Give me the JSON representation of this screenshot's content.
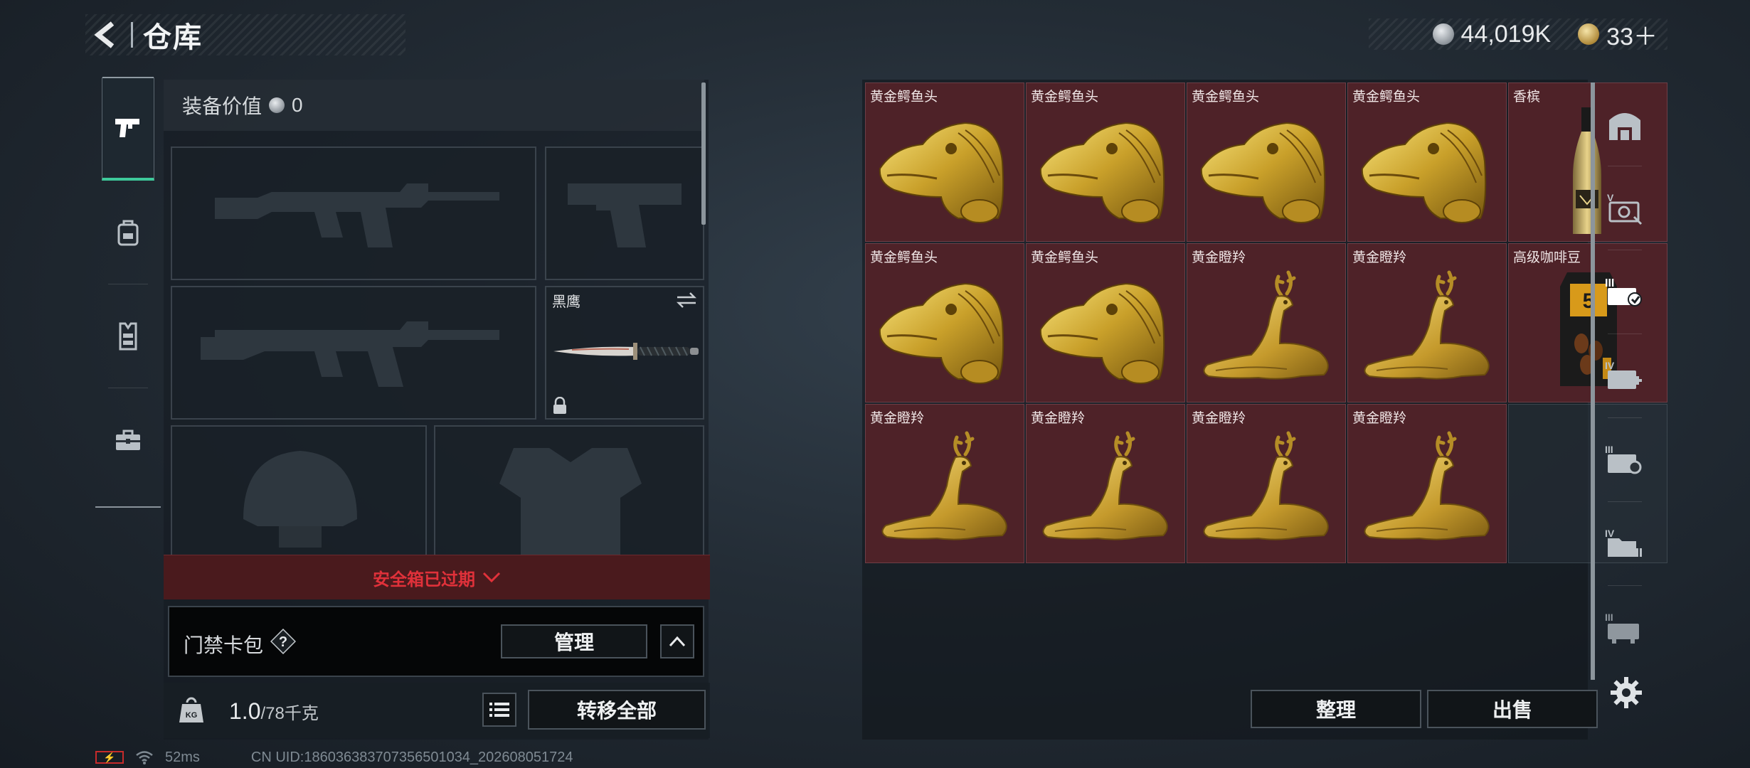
{
  "header": {
    "title": "仓库",
    "silver_amount": "44,019K",
    "gold_amount": "33＋"
  },
  "side_nav": {
    "items": [
      "pistol-icon",
      "backpack-icon",
      "vest-icon",
      "case-icon"
    ],
    "active_index": 0
  },
  "loadout": {
    "equipment_value_label": "装备价值",
    "equipment_value": "0",
    "melee_slot_label": "黑鹰",
    "safe_box_status": "安全箱已过期",
    "keycard": {
      "label": "门禁卡包",
      "help": "?",
      "manage_label": "管理"
    },
    "weight": {
      "current": "1.0",
      "capacity": "/78千克"
    },
    "transfer_all_label": "转移全部"
  },
  "storage": {
    "items": [
      {
        "label": "黄金鳄鱼头",
        "icon": "golden-crocodile-head"
      },
      {
        "label": "黄金鳄鱼头",
        "icon": "golden-crocodile-head"
      },
      {
        "label": "黄金鳄鱼头",
        "icon": "golden-crocodile-head"
      },
      {
        "label": "黄金鳄鱼头",
        "icon": "golden-crocodile-head"
      },
      {
        "label": "香槟",
        "icon": "champagne-bottle"
      },
      {
        "label": "黄金鳄鱼头",
        "icon": "golden-crocodile-head"
      },
      {
        "label": "黄金鳄鱼头",
        "icon": "golden-crocodile-head"
      },
      {
        "label": "黄金瞪羚",
        "icon": "golden-gazelle"
      },
      {
        "label": "黄金瞪羚",
        "icon": "golden-gazelle"
      },
      {
        "label": "高级咖啡豆",
        "icon": "coffee-bean-bag"
      },
      {
        "label": "黄金瞪羚",
        "icon": "golden-gazelle"
      },
      {
        "label": "黄金瞪羚",
        "icon": "golden-gazelle"
      },
      {
        "label": "黄金瞪羚",
        "icon": "golden-gazelle"
      },
      {
        "label": "黄金瞪羚",
        "icon": "golden-gazelle"
      }
    ],
    "sort_label": "整理",
    "sell_label": "出售"
  },
  "status_bar": {
    "battery": "⚡",
    "ping": "52ms",
    "uid": "CN UID:18603638370735650103​4_202608051724"
  },
  "colors": {
    "item_rarity_red": "#4e2228",
    "safe_box_warning": "#e0313a",
    "active_nav_accent": "#3ec99a"
  }
}
